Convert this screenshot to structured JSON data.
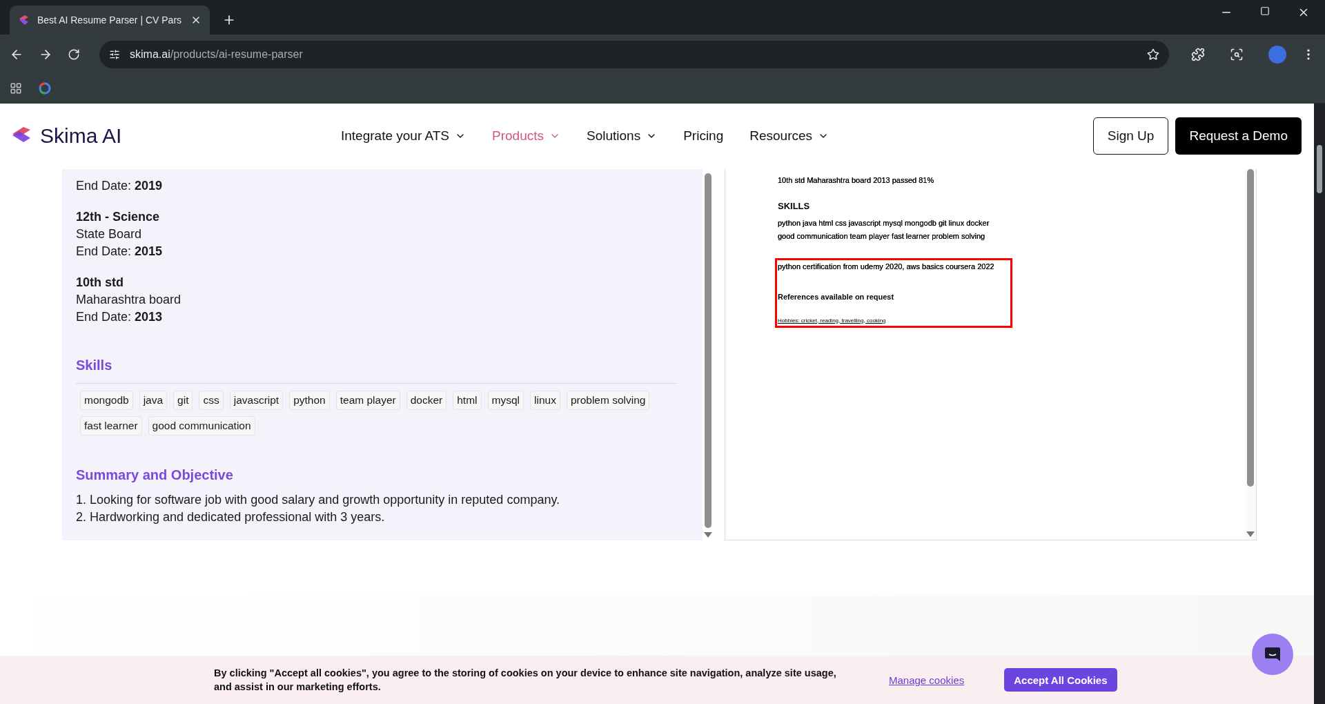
{
  "browser": {
    "tab_title": "Best AI Resume Parser | CV Pars",
    "url_host": "skima.ai",
    "url_path": "/products/ai-resume-parser"
  },
  "nav": {
    "brand": "Skima AI",
    "items": [
      {
        "label": "Integrate your ATS",
        "selected": false,
        "dropdown": true
      },
      {
        "label": "Products",
        "selected": true,
        "dropdown": true
      },
      {
        "label": "Solutions",
        "selected": false,
        "dropdown": true
      },
      {
        "label": "Pricing",
        "selected": false,
        "dropdown": false
      },
      {
        "label": "Resources",
        "selected": false,
        "dropdown": true
      }
    ],
    "sign_up": "Sign Up",
    "demo": "Request a Demo"
  },
  "parsed": {
    "education": [
      {
        "lines": [
          "End Date: **2019**"
        ]
      },
      {
        "title": "12th - Science",
        "lines": [
          "State Board",
          "End Date: **2015**"
        ]
      },
      {
        "title": "10th std",
        "lines": [
          "Maharashtra board",
          "End Date: **2013**"
        ]
      }
    ],
    "skills_heading": "Skills",
    "skills": [
      "mongodb",
      "java",
      "git",
      "css",
      "javascript",
      "python",
      "team player",
      "docker",
      "html",
      "mysql",
      "linux",
      "problem solving",
      "fast learner",
      "good communication"
    ],
    "summary_heading": "Summary and Objective",
    "summary": [
      "1. Looking for software job with good salary and growth opportunity in reputed company.",
      "2. Hardworking and dedicated professional with 3 years."
    ]
  },
  "document": {
    "education_line": "10th std Maharashtra board 2013 passed 81%",
    "skills_heading": "SKILLS",
    "skills_lines": [
      "python java html css javascript mysql mongodb git linux docker",
      "good communication team player fast learner problem solving"
    ],
    "highlight": {
      "certification": "python certification from udemy 2020, aws basics coursera 2022",
      "references": "References available on request",
      "hobbies": "Hobbies: cricket, reading, travelling, cooking"
    }
  },
  "cookies": {
    "text": "By clicking \"Accept all cookies\", you agree to the storing of cookies on your device to enhance site navigation, analyze site usage, and assist in our marketing efforts.",
    "manage": "Manage cookies",
    "accept": "Accept All Cookies"
  }
}
